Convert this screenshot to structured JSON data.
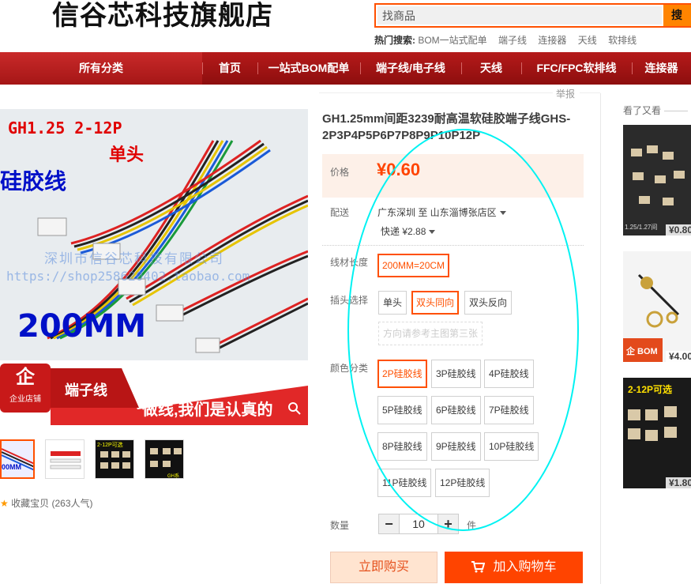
{
  "header": {
    "shop_name": "信谷芯科技旗舰店",
    "search_placeholder": "找商品",
    "search_button": "搜",
    "hot_label": "热门搜索:",
    "hot_links": [
      "BOM一站式配单",
      "端子线",
      "连接器",
      "天线",
      "软排线"
    ]
  },
  "nav": {
    "items": [
      "所有分类",
      "首页",
      "一站式BOM配单",
      "端子线/电子线",
      "天线",
      "FFC/FPC软排线",
      "连接器"
    ]
  },
  "gallery": {
    "main_text": {
      "spec": "GH1.25 2-12P",
      "head": "单头",
      "material": "硅胶线",
      "watermark_cn": "深圳市信谷芯科技有限公司",
      "watermark_url": "https://shop258620402.taobao.com",
      "length": "200MM",
      "badge_big": "企",
      "badge_small": "企业店铺",
      "banner_line1": "端子线",
      "banner_line2": "做线,我们是认真的"
    },
    "thumbs": [
      {
        "label": "00MM"
      },
      {
        "label": ""
      },
      {
        "label": "2-12P可选"
      },
      {
        "label": "GH系列"
      }
    ],
    "favorite_label": "收藏宝贝",
    "favorite_count": "(263人气)"
  },
  "product": {
    "report_label": "举报",
    "title": "GH1.25mm间距3239耐高温软硅胶端子线GHS-2P3P4P5P6P7P8P9P10P12P",
    "price_label": "价格",
    "price": "¥0.60",
    "ship_label": "配送",
    "ship_from_to": "广东深圳 至  山东淄博张店区",
    "ship_fee": "快递 ¥2.88",
    "length_label": "线材长度",
    "length_options": [
      "200MM=20CM"
    ],
    "plug_label": "插头选择",
    "plug_options": [
      "单头",
      "双头同向",
      "双头反向"
    ],
    "plug_note": "方向请参考主图第三张",
    "color_label": "颜色分类",
    "color_options": [
      "2P硅胶线",
      "3P硅胶线",
      "4P硅胶线",
      "5P硅胶线",
      "6P硅胶线",
      "7P硅胶线",
      "8P硅胶线",
      "9P硅胶线",
      "10P硅胶线",
      "11P硅胶线",
      "12P硅胶线"
    ],
    "qty_label": "数量",
    "qty_minus": "−",
    "qty_value": "10",
    "qty_plus": "+",
    "qty_unit": "件",
    "buy_now": "立即购买",
    "add_cart": "加入购物车"
  },
  "sidebar": {
    "title": "看了又看",
    "items": [
      {
        "caption": "1.25/1.27间",
        "price": "¥0.80"
      },
      {
        "caption": "企 BOM",
        "price": "¥4.00"
      },
      {
        "caption": "2-12P可选",
        "price": "¥1.80"
      }
    ]
  },
  "colors": {
    "accent": "#ff5000",
    "nav_red": "#a51616",
    "annotation_cyan": "#00f2f2"
  }
}
